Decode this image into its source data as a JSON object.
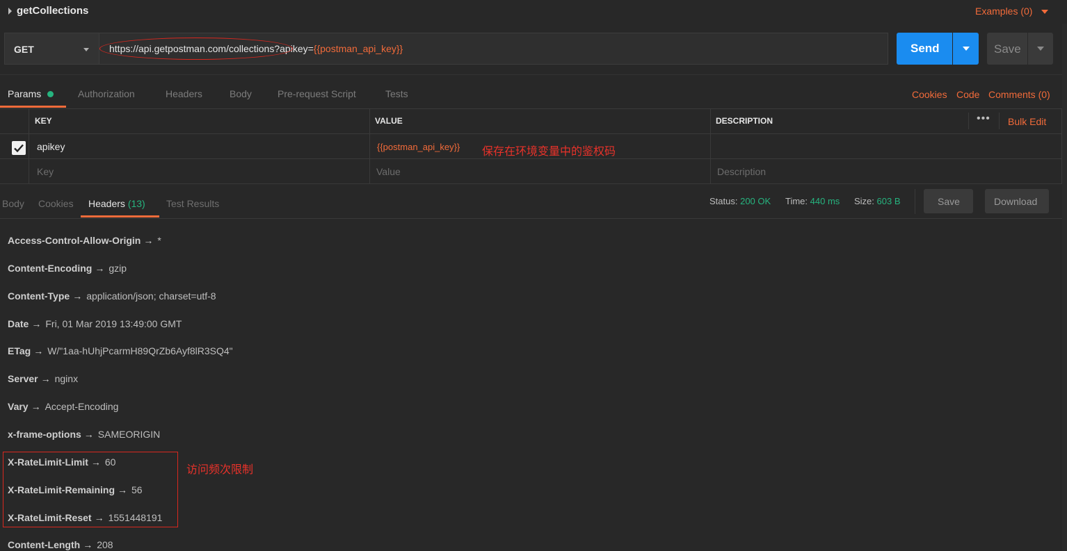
{
  "request": {
    "title": "getCollections",
    "examples_label": "Examples (0)",
    "method": "GET",
    "url_base": "https://api.getpostman.com/collections?apikey=",
    "url_var": "{{postman_api_key}}",
    "send_label": "Send",
    "save_label": "Save"
  },
  "request_tabs": {
    "params": "Params",
    "authorization": "Authorization",
    "headers": "Headers",
    "body": "Body",
    "prerequest": "Pre-request Script",
    "tests": "Tests",
    "cookies": "Cookies",
    "code": "Code",
    "comments": "Comments (0)"
  },
  "params_table": {
    "col_key": "KEY",
    "col_value": "VALUE",
    "col_description": "DESCRIPTION",
    "bulk_edit": "Bulk Edit",
    "more": "•••",
    "row": {
      "key": "apikey",
      "value": "{{postman_api_key}}",
      "checked": true
    },
    "placeholder_key": "Key",
    "placeholder_value": "Value",
    "placeholder_description": "Description"
  },
  "annotations": {
    "value_note": "保存在环境变量中的鉴权码",
    "rate_note": "访问频次限制"
  },
  "response": {
    "tabs": {
      "body": "Body",
      "cookies": "Cookies",
      "headers": "Headers",
      "headers_count": "(13)",
      "test_results": "Test Results"
    },
    "status_label": "Status:",
    "status_value": "200 OK",
    "time_label": "Time:",
    "time_value": "440 ms",
    "size_label": "Size:",
    "size_value": "603 B",
    "save_label": "Save",
    "download_label": "Download",
    "arrow": "→",
    "headers": [
      {
        "key": "Access-Control-Allow-Origin",
        "value": "*"
      },
      {
        "key": "Content-Encoding",
        "value": "gzip"
      },
      {
        "key": "Content-Type",
        "value": "application/json; charset=utf-8"
      },
      {
        "key": "Date",
        "value": "Fri, 01 Mar 2019 13:49:00 GMT"
      },
      {
        "key": "ETag",
        "value": "W/\"1aa-hUhjPcarmH89QrZb6Ayf8lR3SQ4\""
      },
      {
        "key": "Server",
        "value": "nginx"
      },
      {
        "key": "Vary",
        "value": "Accept-Encoding"
      },
      {
        "key": "x-frame-options",
        "value": "SAMEORIGIN"
      },
      {
        "key": "X-RateLimit-Limit",
        "value": "60"
      },
      {
        "key": "X-RateLimit-Remaining",
        "value": "56"
      },
      {
        "key": "X-RateLimit-Reset",
        "value": "1551448191"
      },
      {
        "key": "Content-Length",
        "value": "208"
      }
    ]
  },
  "colors": {
    "accent": "#f26b3a",
    "primary": "#1a8cf0",
    "success": "#26b47f",
    "annotation": "#d9281f"
  }
}
